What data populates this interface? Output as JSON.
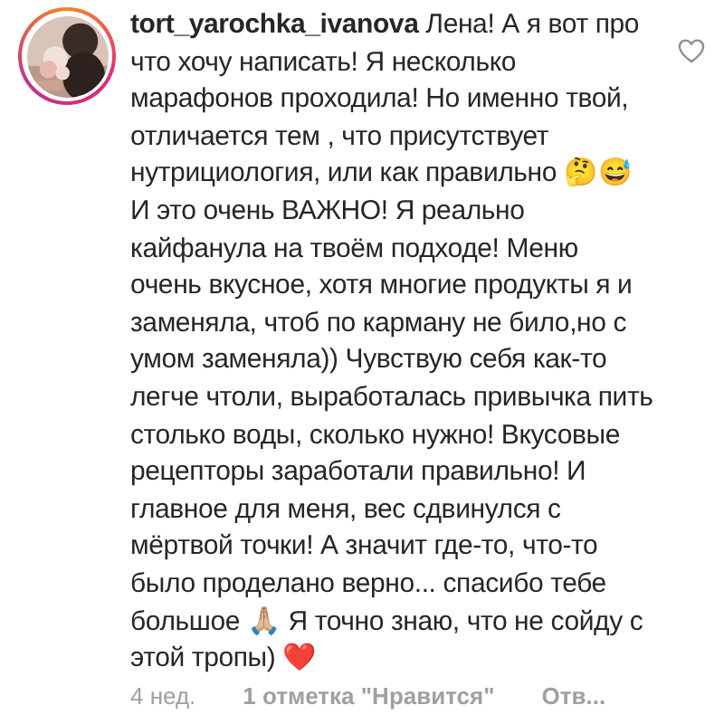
{
  "comment": {
    "text": "**tort_yarochka_ivanova** Лена! А я вот про что хочу написать! Я несколько марафонов проходила! Но именно твой, отличается тем , что присутствует нутрициология, или как правильно 🤔😅 И это очень ВАЖНО! Я реально кайфанула на твоём подходе! Меню очень вкусное, хотя многие продукты я и заменяла, чтоб по карману не било,но с умом заменяла)) Чувствую себя как-то легче чтоли, выработалась привычка пить столько воды, сколько нужно! Вкусовые рецепторы заработали правильно! И главное для меня, вес сдвинулся с мёртвой точки! А значит где-то, что-то было проделано верно... спасибо тебе большое 🙏🏼 Я точно знаю, что не сойду с этой тропы) ❤️",
    "liked": false,
    "time": "4 нед.",
    "likes": "1 отметка \"Нравится\"",
    "reply": "Отв..."
  }
}
